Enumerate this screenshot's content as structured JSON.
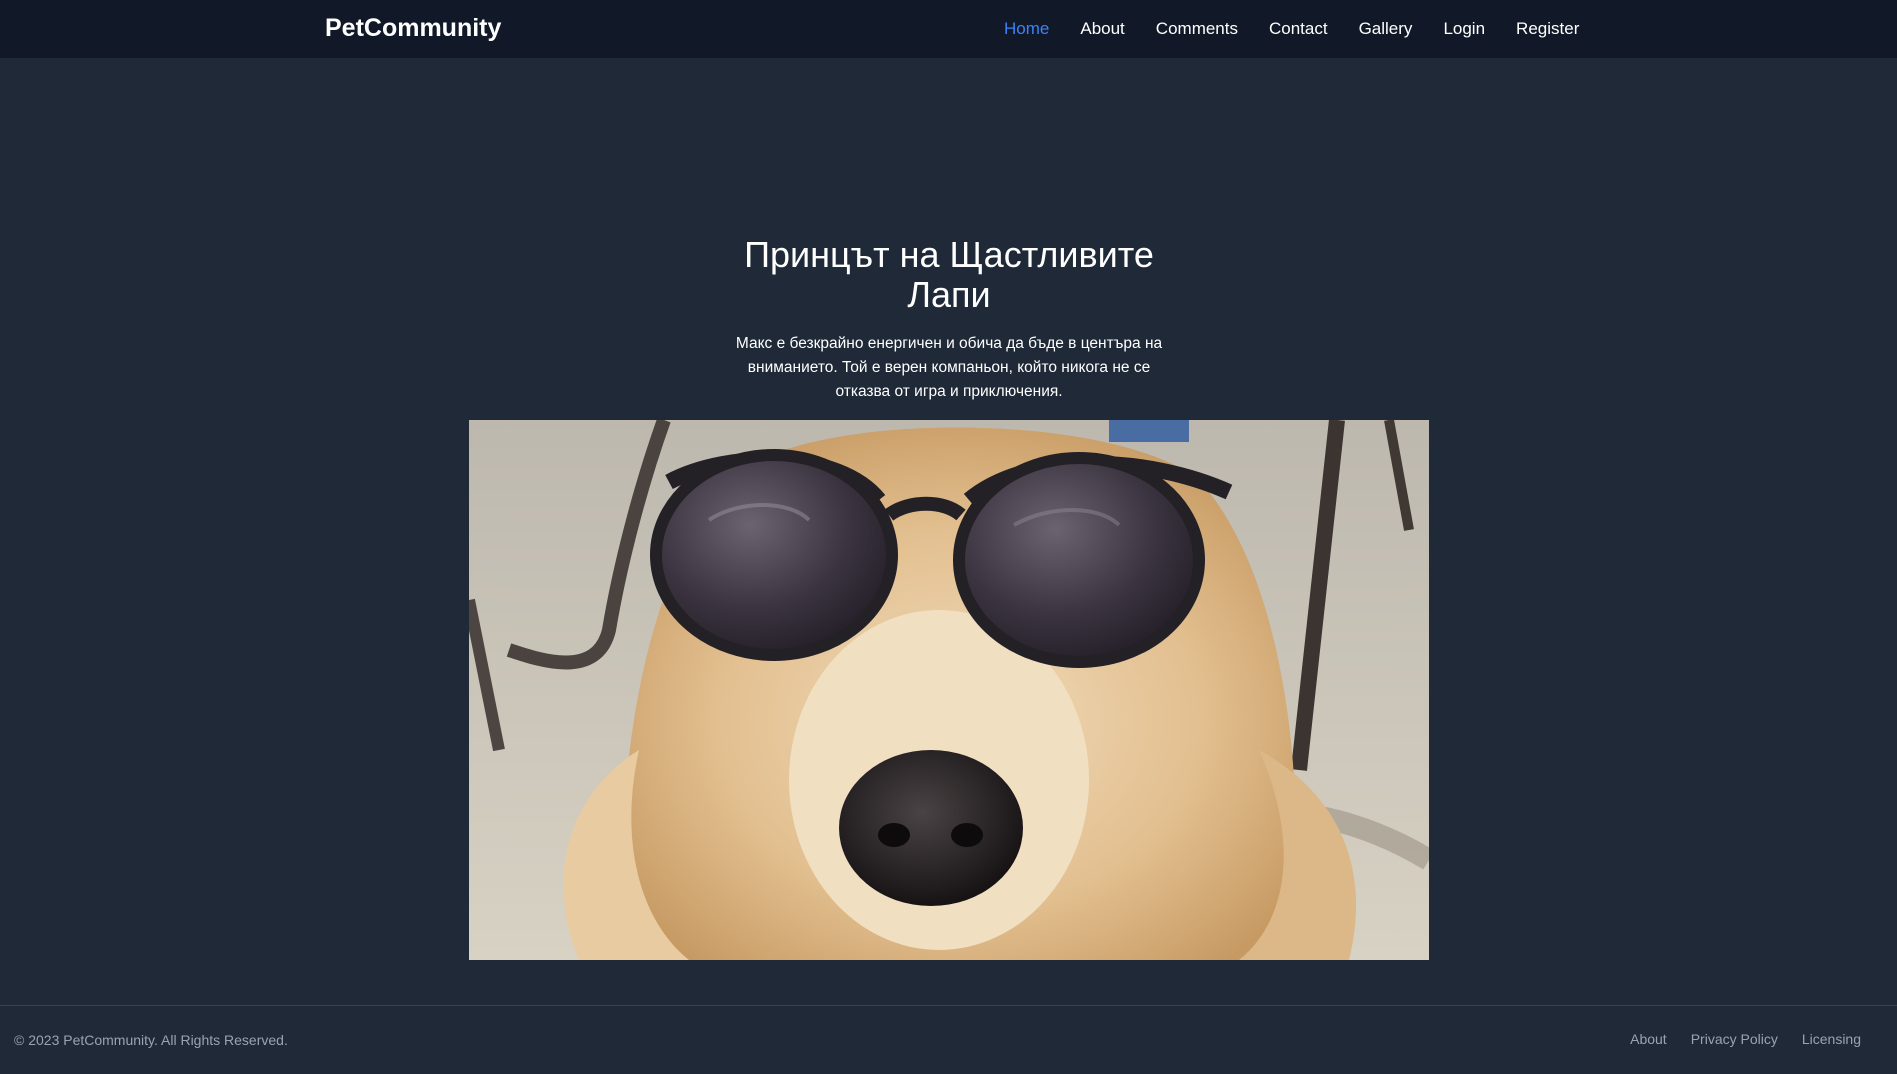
{
  "navbar": {
    "brand": "PetCommunity",
    "links": [
      {
        "label": "Home",
        "active": true
      },
      {
        "label": "About"
      },
      {
        "label": "Comments"
      },
      {
        "label": "Contact"
      },
      {
        "label": "Gallery"
      },
      {
        "label": "Login"
      },
      {
        "label": "Register"
      }
    ]
  },
  "hero": {
    "title": "Принцът на Щастливите Лапи",
    "description": "Макс е безкрайно енергичен и обича да бъде в центъра на вниманието. Той е верен компаньон, който никога не се отказва от игра и приключения."
  },
  "footer": {
    "copyright": "© 2023 PetCommunity. All Rights Reserved.",
    "links": [
      "About",
      "Privacy Policy",
      "Licensing"
    ]
  },
  "colors": {
    "navbar_bg": "#111827",
    "page_bg": "#1f2937",
    "active_link": "#3b82f6",
    "footer_text": "#9ca3af"
  }
}
